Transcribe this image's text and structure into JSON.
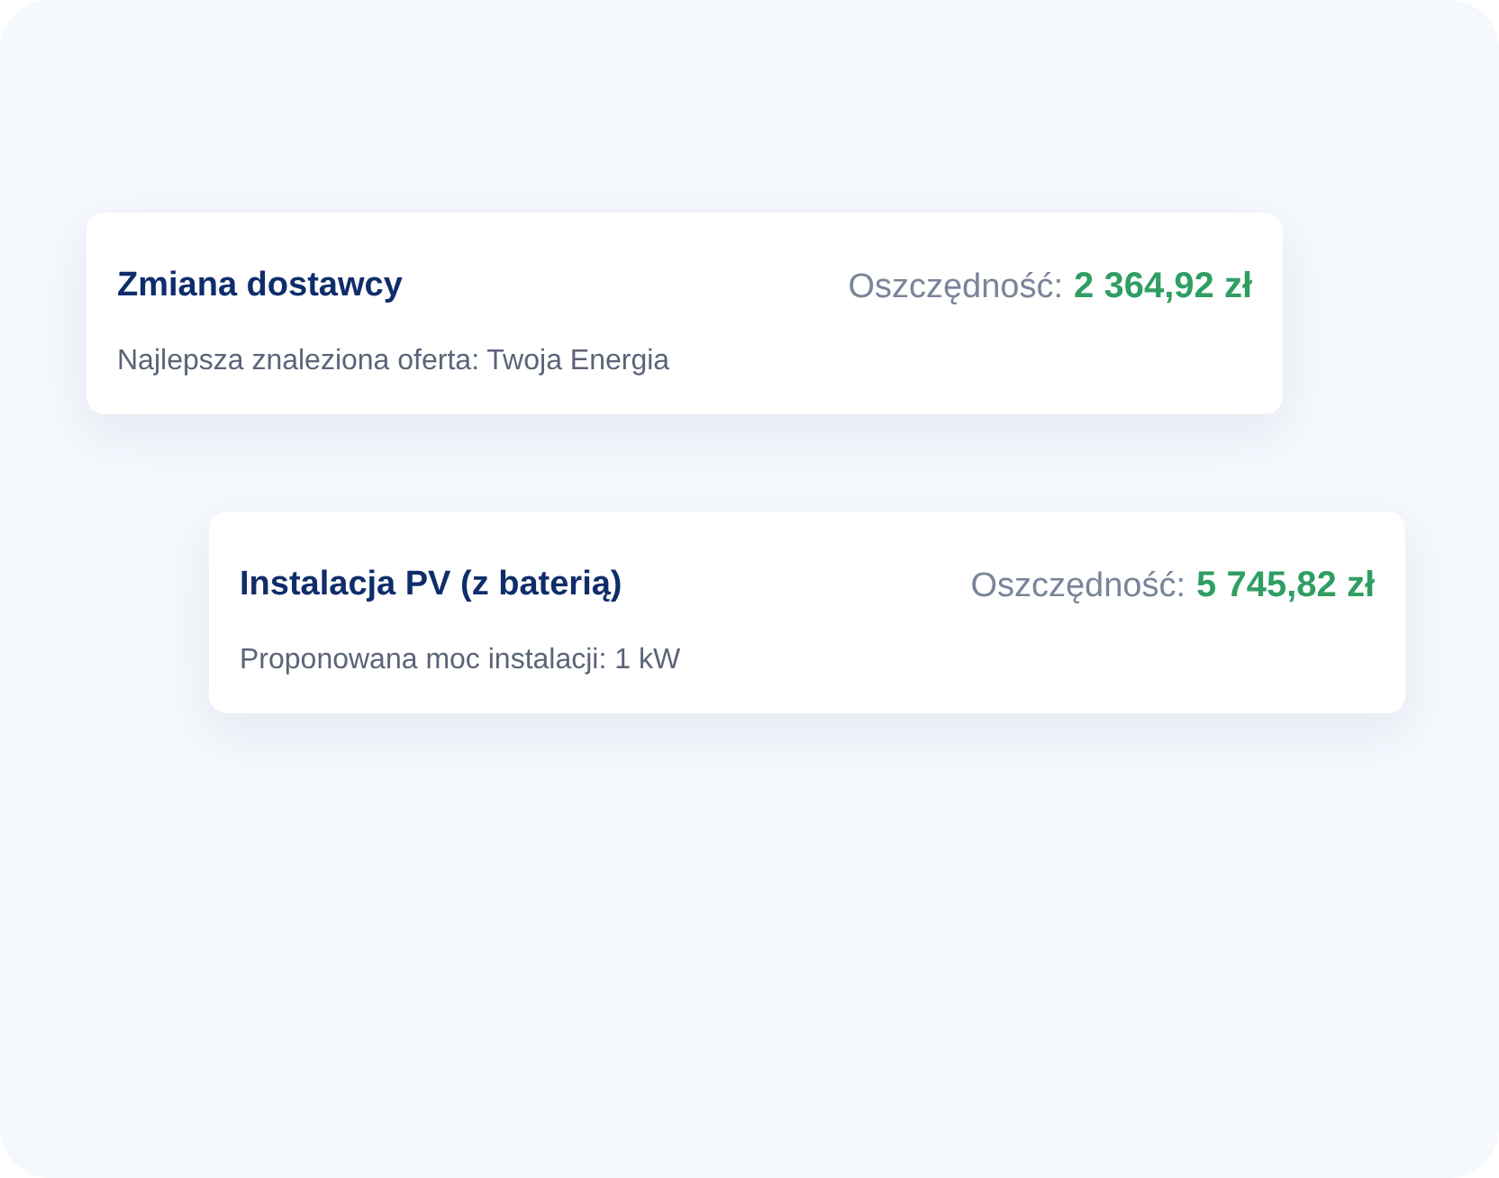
{
  "offers": [
    {
      "title": "Zmiana dostawcy",
      "savings_label": "Oszczędność:",
      "savings_value": "2 364,92 zł",
      "detail": "Najlepsza znaleziona oferta: Twoja Energia"
    },
    {
      "title": "Instalacja PV (z baterią)",
      "savings_label": "Oszczędność:",
      "savings_value": "5 745,82 zł",
      "detail": "Proponowana moc instalacji: 1 kW"
    }
  ]
}
